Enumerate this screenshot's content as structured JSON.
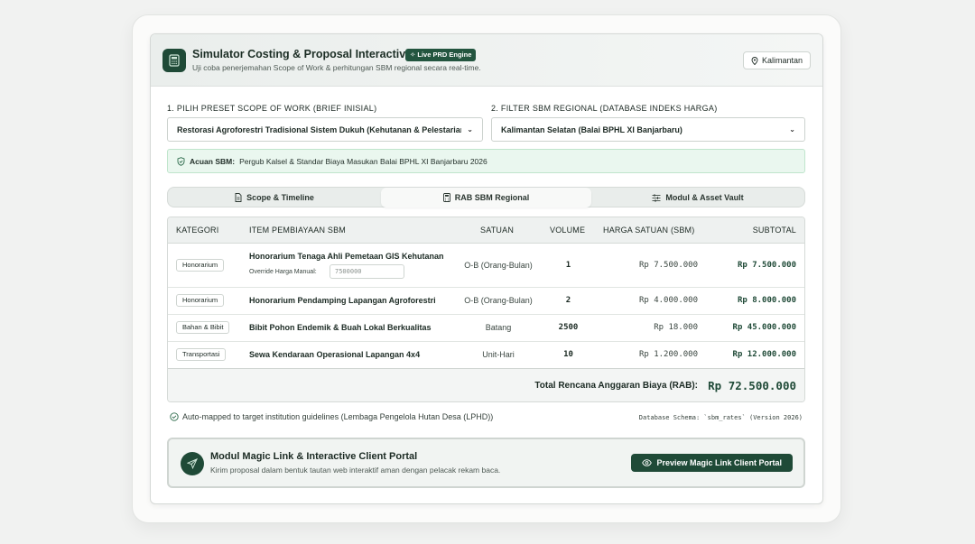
{
  "header": {
    "title": "Simulator Costing & Proposal Interactive",
    "badge": "Live PRD Engine",
    "subtitle": "Uji coba penerjemahan Scope of Work & perhitungan SBM regional secara real-time.",
    "region_button": "Kalimantan"
  },
  "filters": {
    "preset_label": "1. PILIH PRESET SCOPE OF WORK (BRIEF INISIAL)",
    "preset_value": "Restorasi Agroforestri Tradisional Sistem Dukuh (Kehutanan & Pelestarian",
    "sbm_label": "2. FILTER SBM REGIONAL (DATABASE INDEKS HARGA)",
    "sbm_value": "Kalimantan Selatan (Balai BPHL XI Banjarbaru)"
  },
  "sbm_banner": {
    "prefix": "Acuan SBM:",
    "text": "Pergub Kalsel & Standar Biaya Masukan Balai BPHL XI Banjarbaru 2026"
  },
  "tabs": [
    {
      "label": "Scope & Timeline",
      "icon": "document-icon"
    },
    {
      "label": "RAB SBM Regional",
      "icon": "calculator-icon",
      "active": true
    },
    {
      "label": "Modul & Asset Vault",
      "icon": "sliders-icon"
    }
  ],
  "table": {
    "headers": {
      "kategori": "KATEGORI",
      "item": "ITEM PEMBIAYAAN SBM",
      "satuan": "SATUAN",
      "volume": "VOLUME",
      "harga": "HARGA SATUAN (SBM)",
      "subtotal": "SUBTOTAL"
    },
    "rows": [
      {
        "kategori": "Honorarium",
        "item": "Honorarium Tenaga Ahli Pemetaan GIS Kehutanan",
        "satuan": "O-B (Orang-Bulan)",
        "volume": "1",
        "harga": "Rp 7.500.000",
        "subtotal": "Rp 7.500.000"
      },
      {
        "kategori": "Honorarium",
        "item": "Honorarium Pendamping Lapangan Agroforestri",
        "satuan": "O-B (Orang-Bulan)",
        "volume": "2",
        "harga": "Rp 4.000.000",
        "subtotal": "Rp 8.000.000"
      },
      {
        "kategori": "Bahan & Bibit",
        "item": "Bibit Pohon Endemik & Buah Lokal Berkualitas",
        "satuan": "Batang",
        "volume": "2500",
        "harga": "Rp 18.000",
        "subtotal": "Rp 45.000.000"
      },
      {
        "kategori": "Transportasi",
        "item": "Sewa Kendaraan Operasional Lapangan 4x4",
        "satuan": "Unit-Hari",
        "volume": "10",
        "harga": "Rp 1.200.000",
        "subtotal": "Rp 12.000.000"
      }
    ],
    "override_label": "Override Harga Manual:",
    "override_placeholder": "7500000",
    "total_label": "Total Rencana Anggaran Biaya (RAB):",
    "total_value": "Rp 72.500.000"
  },
  "footer": {
    "note": "Auto-mapped to target institution guidelines (Lembaga Pengelola Hutan Desa (LPHD))",
    "schema": "Database Schema: `sbm_rates` (Version 2026)"
  },
  "magic": {
    "title": "Modul Magic Link & Interactive Client Portal",
    "subtitle": "Kirim proposal dalam bentuk tautan web interaktif aman dengan pelacak rekam baca.",
    "button": "Preview Magic Link Client Portal"
  },
  "colors": {
    "brand_green": "#1f4a37",
    "banner_bg": "#eaf7ef",
    "banner_border": "#bfe5cc"
  }
}
